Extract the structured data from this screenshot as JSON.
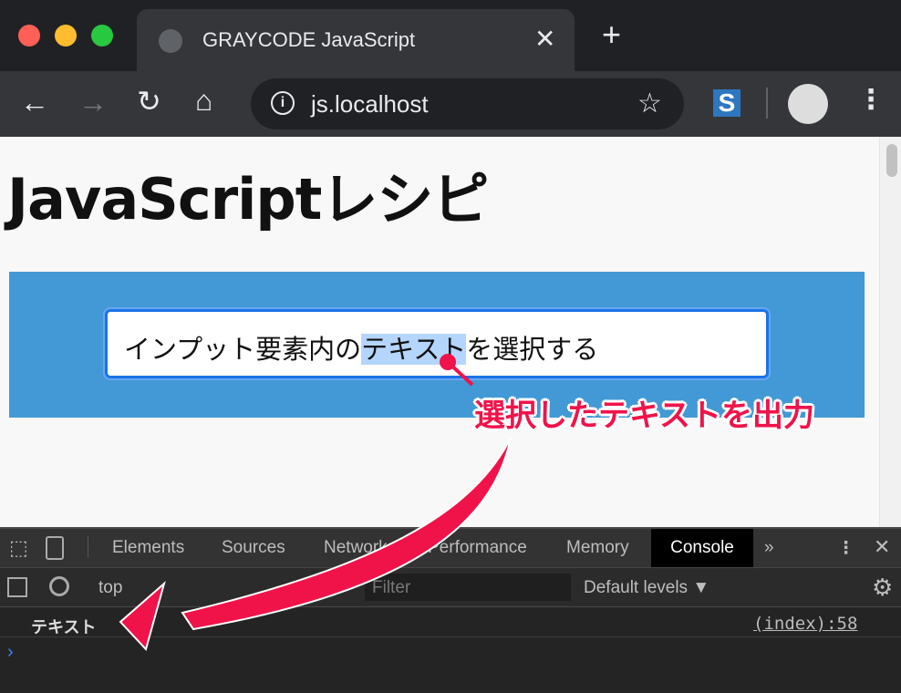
{
  "browser": {
    "tab_title": "GRAYCODE JavaScript",
    "url": "js.localhost"
  },
  "page": {
    "heading": "JavaScriptレシピ",
    "input_before": "インプット要素内の",
    "input_selected": "テキスト",
    "input_after": "を選択する",
    "annotation": "選択したテキストを出力"
  },
  "devtools": {
    "tabs": [
      "Elements",
      "Sources",
      "Network",
      "Performance",
      "Memory",
      "Console"
    ],
    "active_tab": "Console",
    "more": "»",
    "context": "top",
    "filter_placeholder": "Filter",
    "levels": "Default levels ▼",
    "log_message": "テキスト",
    "log_source": "(index):58",
    "prompt": "›"
  },
  "colors": {
    "accent_blue": "#4299d5",
    "annotation_red": "#f0134a"
  }
}
